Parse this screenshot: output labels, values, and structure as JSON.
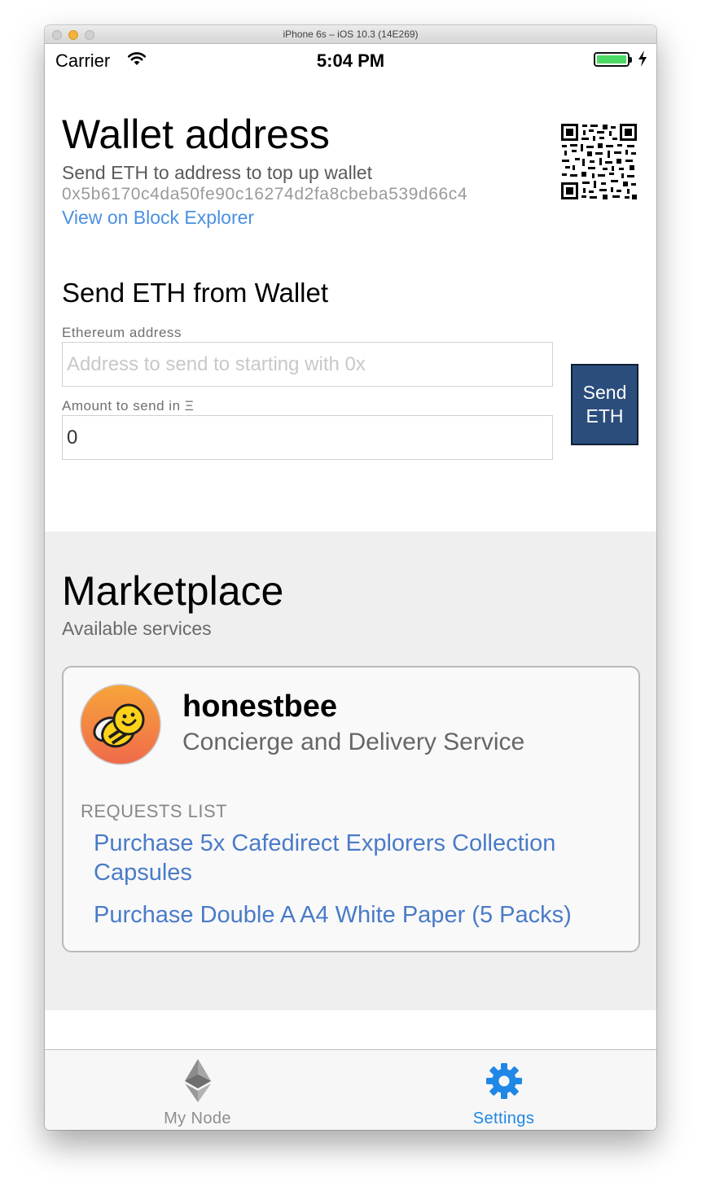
{
  "window": {
    "title": "iPhone 6s – iOS 10.3 (14E269)"
  },
  "status_bar": {
    "carrier": "Carrier",
    "time": "5:04 PM"
  },
  "wallet": {
    "heading": "Wallet address",
    "subtitle": "Send ETH to address to top up wallet",
    "address": "0x5b6170c4da50fe90c16274d2fa8cbeba539d66c4",
    "explorer_link": "View on Block Explorer"
  },
  "send_form": {
    "heading": "Send ETH from Wallet",
    "address_label": "Ethereum address",
    "address_placeholder": "Address to send to starting with 0x",
    "address_value": "",
    "amount_label": "Amount to send in Ξ",
    "amount_value": "0",
    "send_button": "Send ETH"
  },
  "marketplace": {
    "heading": "Marketplace",
    "subtitle": "Available services",
    "services": [
      {
        "name": "honestbee",
        "description": "Concierge and Delivery Service",
        "requests_header": "REQUESTS LIST",
        "requests": [
          "Purchase 5x Cafedirect Explorers Collection Capsules",
          "Purchase Double A A4 White Paper (5 Packs)"
        ]
      }
    ]
  },
  "tab_bar": {
    "tabs": [
      {
        "label": "My Node",
        "icon": "ethereum-icon",
        "active": false
      },
      {
        "label": "Settings",
        "icon": "gear-icon",
        "active": true
      }
    ]
  },
  "colors": {
    "link": "#4a90e2",
    "request_link": "#4a7bc8",
    "send_button": "#2a4d7b",
    "tab_active": "#1f87e6",
    "marketplace_bg": "#efefef",
    "battery": "#4cd964"
  }
}
